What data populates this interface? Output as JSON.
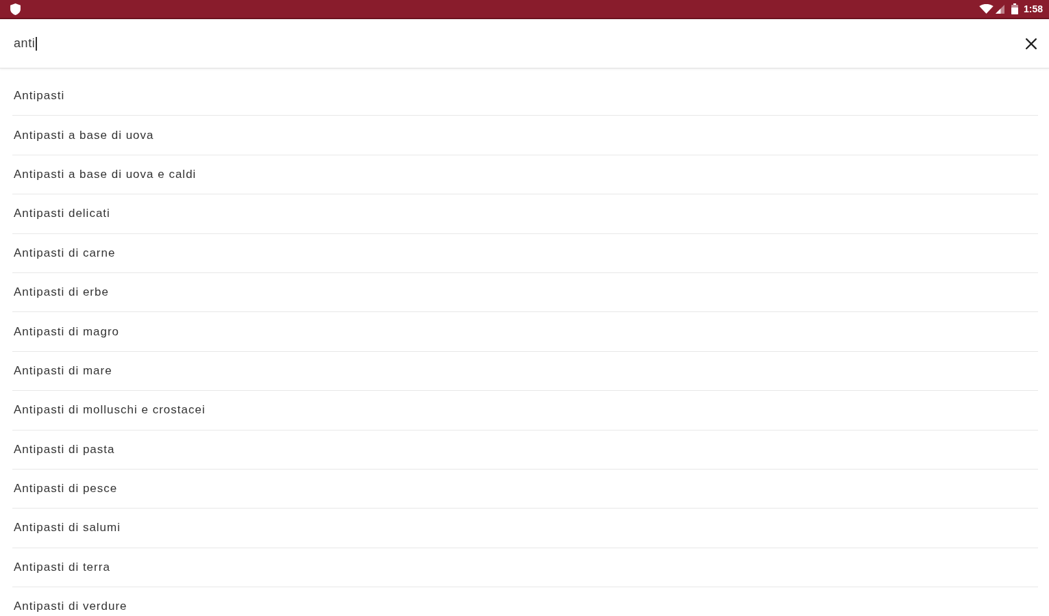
{
  "status_bar": {
    "time": "1:58"
  },
  "search": {
    "value": "anti",
    "focused": true
  },
  "suggestions": [
    "Antipasti",
    "Antipasti a base di uova",
    "Antipasti a base di uova e caldi",
    "Antipasti delicati",
    "Antipasti di carne",
    "Antipasti di erbe",
    "Antipasti di magro",
    "Antipasti di mare",
    "Antipasti di molluschi e crostacei",
    "Antipasti di pasta",
    "Antipasti di pesce",
    "Antipasti di salumi",
    "Antipasti di terra",
    "Antipasti di verdure"
  ]
}
